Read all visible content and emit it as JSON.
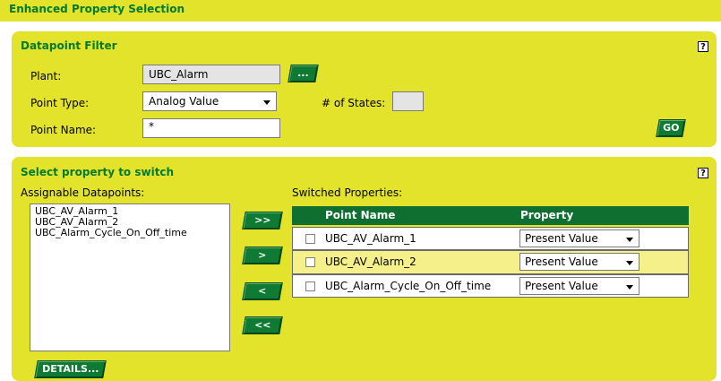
{
  "header": {
    "title": "Enhanced Property Selection"
  },
  "filter": {
    "title": "Datapoint Filter",
    "help": "?",
    "plant_label": "Plant:",
    "plant_value": "UBC_Alarm",
    "browse_label": "...",
    "point_type_label": "Point Type:",
    "point_type_value": "Analog Value",
    "num_states_label": "# of States:",
    "num_states_value": "",
    "point_name_label": "Point Name:",
    "point_name_value": "*",
    "go_label": "GO"
  },
  "switch": {
    "title": "Select property to switch",
    "help": "?",
    "assignable_label": "Assignable Datapoints:",
    "assignable": [
      "UBC_AV_Alarm_1",
      "UBC_AV_Alarm_2",
      "UBC_Alarm_Cycle_On_Off_time"
    ],
    "switched_label": "Switched Properties:",
    "col_point_name": "Point Name",
    "col_property": "Property",
    "rows": [
      {
        "name": "UBC_AV_Alarm_1",
        "property": "Present Value",
        "checked": false
      },
      {
        "name": "UBC_AV_Alarm_2",
        "property": "Present Value",
        "checked": false
      },
      {
        "name": "UBC_Alarm_Cycle_On_Off_time",
        "property": "Present Value",
        "checked": false
      }
    ],
    "btn_add_all": ">>",
    "btn_add": ">",
    "btn_remove": "<",
    "btn_remove_all": "<<",
    "details_label": "DETAILS..."
  },
  "colors": {
    "panel": "#e2e32a",
    "title_text": "#007a2d",
    "button": "#0e7a33",
    "table_header": "#0e6f30",
    "row_highlight": "#f6f08a"
  }
}
